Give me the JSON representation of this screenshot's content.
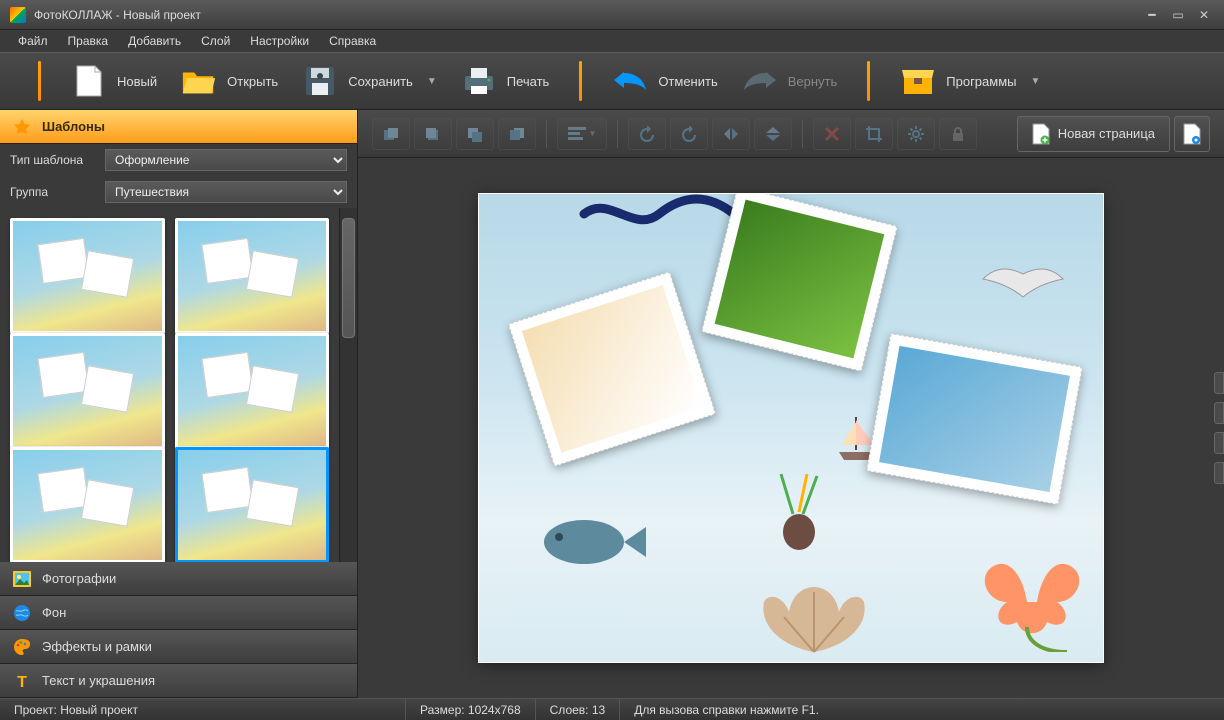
{
  "app": {
    "title": "ФотоКОЛЛАЖ - Новый проект"
  },
  "menu": {
    "file": "Файл",
    "edit": "Правка",
    "add": "Добавить",
    "layer": "Слой",
    "settings": "Настройки",
    "help": "Справка"
  },
  "toolbar": {
    "new": "Новый",
    "open": "Открыть",
    "save": "Сохранить",
    "print": "Печать",
    "undo": "Отменить",
    "redo": "Вернуть",
    "programs": "Программы"
  },
  "sidebar": {
    "templates": "Шаблоны",
    "type_label": "Тип шаблона",
    "type_value": "Оформление",
    "group_label": "Группа",
    "group_value": "Путешествия",
    "photos": "Фотографии",
    "background": "Фон",
    "effects": "Эффекты и рамки",
    "text": "Текст и украшения"
  },
  "canvas": {
    "new_page": "Новая страница"
  },
  "status": {
    "project_label": "Проект: Новый проект",
    "size_label": "Размер: 1024x768",
    "layers_label": "Слоев: 13",
    "help_hint": "Для вызова справки нажмите F1."
  }
}
